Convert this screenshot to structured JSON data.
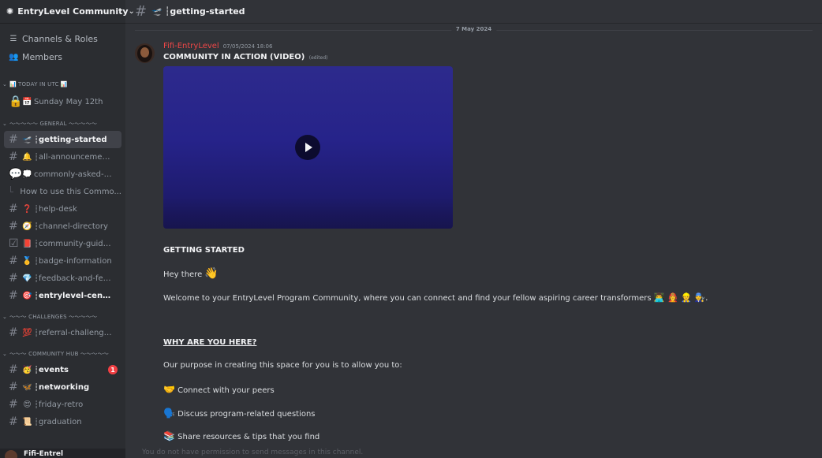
{
  "server": {
    "name": "EntryLevel Community"
  },
  "nav": [
    {
      "label": "Channels & Roles",
      "icon": "channels-roles-icon"
    },
    {
      "label": "Members",
      "icon": "members-icon"
    }
  ],
  "cat_today": "TODAY IN UTC",
  "today_item": {
    "emoji": "📅",
    "label": "Sunday May 12th"
  },
  "cat_general": "〜〜〜〜〜 GENERAL 〜〜〜〜〜",
  "general": [
    {
      "emoji": "🛫",
      "label": "┆getting-started"
    },
    {
      "emoji": "🔔",
      "label": "┆all-announcements"
    },
    {
      "emoji": "💭",
      "label": "commonly-asked-qu..."
    },
    {
      "emoji": "",
      "label": "How to use this Commo..."
    },
    {
      "emoji": "❓",
      "label": "┆help-desk"
    },
    {
      "emoji": "🧭",
      "label": "┆channel-directory"
    },
    {
      "emoji": "📕",
      "label": "┆community-guideli..."
    },
    {
      "emoji": "🥇",
      "label": "┆badge-information"
    },
    {
      "emoji": "💎",
      "label": "┆feedback-and-feat..."
    },
    {
      "emoji": "🎯",
      "label": "┆entrylevel-central"
    }
  ],
  "cat_challenges": "〜〜〜 CHALLENGES 〜〜〜〜〜",
  "challenges": [
    {
      "emoji": "💯",
      "label": "┆referral-challenge-..."
    }
  ],
  "cat_hub": "〜〜〜 COMMUNITY HUB 〜〜〜〜〜",
  "hub": [
    {
      "emoji": "🥳",
      "label": "┆events",
      "badge": "1"
    },
    {
      "emoji": "🦋",
      "label": "┆networking"
    },
    {
      "emoji": "😍",
      "label": "┆friday-retro"
    },
    {
      "emoji": "📜",
      "label": "┆graduation"
    }
  ],
  "user": {
    "name": "Fifi-Entrel"
  },
  "topbar": {
    "emoji": "🛫",
    "name": "┆getting-started"
  },
  "date_divider": "7 May 2024",
  "message": {
    "author": "Fifi-EntryLevel",
    "time": "07/05/2024 18:06",
    "title": "COMMUNITY IN ACTION (VIDEO)",
    "edited": "(edited)",
    "lines": {
      "getting_started": "GETTING STARTED",
      "hey": "Hey there",
      "hey_emoji": "👋",
      "welcome": "Welcome to your EntryLevel Program Community, where you can connect and find your fellow aspiring career transformers",
      "welcome_emoji": "👨‍💻 👩‍🚒 👷 👨‍🔧.",
      "why": "WHY ARE YOU HERE?",
      "purpose": "Our purpose in creating this space for you is to allow you to:",
      "b1_emoji": "🤝",
      "b1": "Connect with your peers",
      "b2_emoji": "🗣️",
      "b2": "Discuss program-related questions",
      "b3_emoji": "📚",
      "b3": "Share resources & tips that you find"
    }
  },
  "input_placeholder": "You do not have permission to send messages in this channel."
}
